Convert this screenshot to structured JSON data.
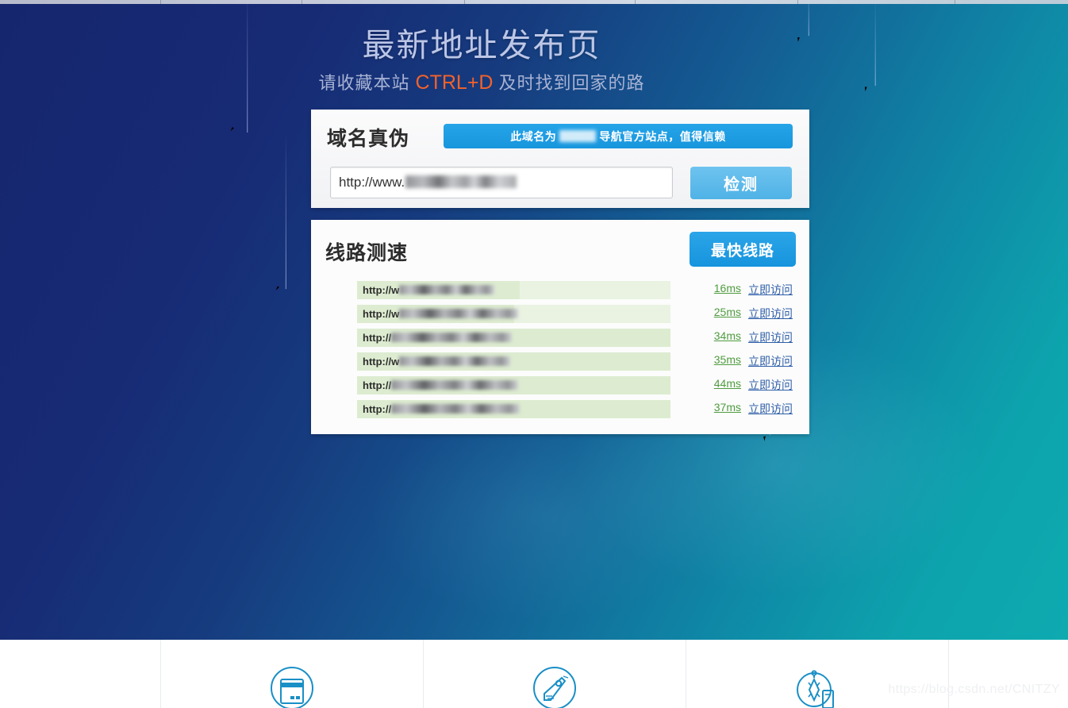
{
  "hero": {
    "title": "最新地址发布页",
    "subtitle_before": "请收藏本站",
    "hotkey": "CTRL+D",
    "subtitle_after": "及时找到回家的路"
  },
  "verify_card": {
    "label": "域名真伪",
    "banner_before": "此域名为",
    "banner_after": "导航官方站点，值得信赖",
    "url_value": "http://www.",
    "detect_button": "检测"
  },
  "speed_card": {
    "title": "线路测速",
    "fastest_button": "最快线路",
    "visit_label": "立即访问",
    "rows": [
      {
        "url_prefix": "http://w",
        "latency": "16ms",
        "visit": "立即访问",
        "fill_pct": 52,
        "blob_w": 120
      },
      {
        "url_prefix": "http://w",
        "latency": "25ms",
        "visit": "立即访问",
        "fill_pct": 50,
        "blob_w": 150
      },
      {
        "url_prefix": "http://",
        "latency": "34ms",
        "visit": "立即访问",
        "fill_pct": 100,
        "blob_w": 152
      },
      {
        "url_prefix": "http://w",
        "latency": "35ms",
        "visit": "立即访问",
        "fill_pct": 100,
        "blob_w": 140
      },
      {
        "url_prefix": "http://",
        "latency": "44ms",
        "visit": "立即访问",
        "fill_pct": 100,
        "blob_w": 160
      },
      {
        "url_prefix": "http://",
        "latency": "37ms",
        "visit": "立即访问",
        "fill_pct": 100,
        "blob_w": 162
      }
    ]
  },
  "footer": {
    "icons": [
      "window-card-icon",
      "price-tag-icon",
      "compass-icon"
    ]
  },
  "watermark": "https://blog.csdn.net/CNITZY",
  "colors": {
    "hero_navy": "#16266e",
    "hero_teal": "#0eaab0",
    "accent_blue": "#1796dd",
    "detect_blue": "#4fb2e6",
    "hot_orange": "#f4622a",
    "bar_green": "#eaf3e2",
    "bar_fill_green": "#ddecd0",
    "latency_green": "#4f9c3f",
    "link_blue": "#2f5fa8",
    "icon_blue": "#1a8fc6"
  }
}
